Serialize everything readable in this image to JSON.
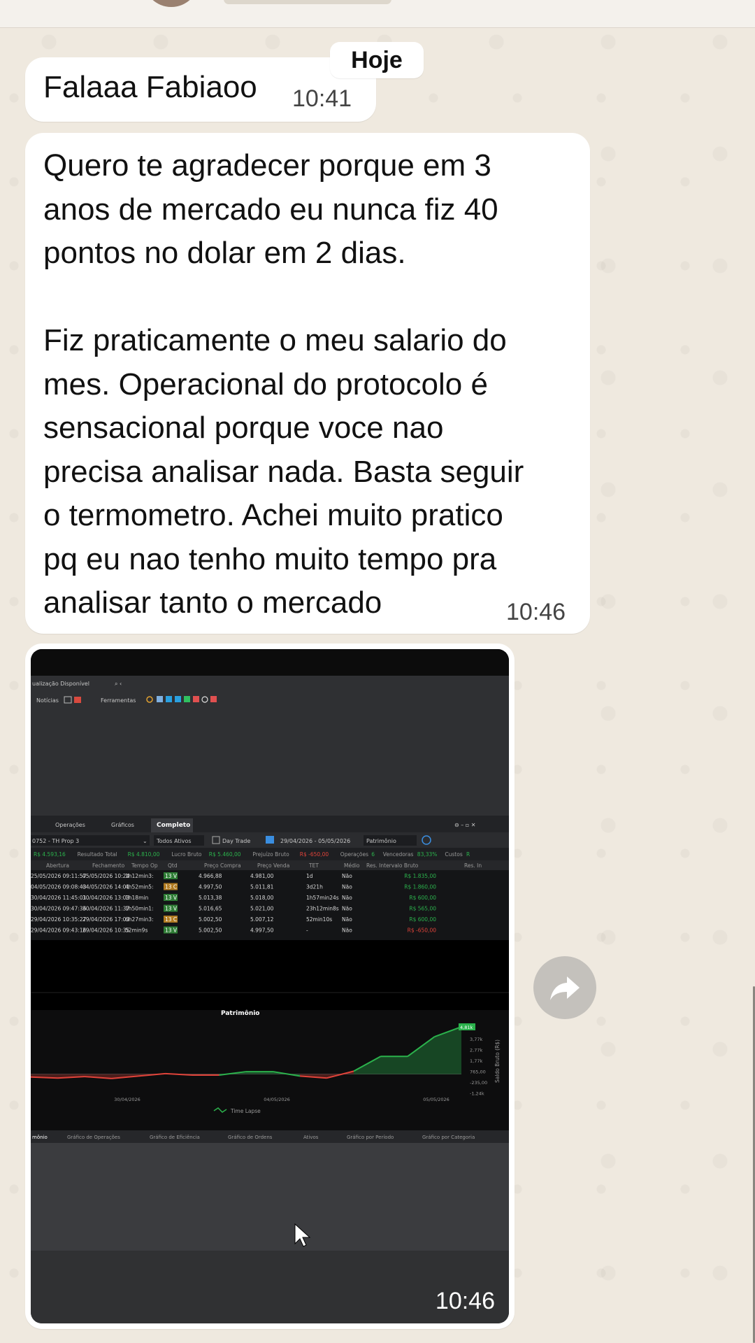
{
  "date_chip": "Hoje",
  "messages": [
    {
      "text": "Falaaa Fabiaoo",
      "time": "10:41"
    },
    {
      "text": "Quero te agradecer porque em 3\nanos de mercado eu nunca fiz 40\npontos no dolar em 2 dias.\n\nFiz praticamente o meu salario do\nmes. Operacional do protocolo é\nsensacional porque voce nao\nprecisa analisar nada. Basta seguir\no termometro. Achei muito pratico\npq eu nao tenho muito tempo pra\nanalisar tanto o mercado",
      "time": "10:46"
    }
  ],
  "media_message": {
    "time": "10:46",
    "forward_icon": "forward-arrow-icon",
    "screenshot": {
      "top_bar_text": "ualização Disponível",
      "menu": [
        "Notícias",
        "Ferramentas"
      ],
      "tabs": [
        "Operações",
        "Gráficos",
        "Completo"
      ],
      "filters": {
        "account": "0752 - TH Prop 3",
        "assets": "Todos Ativos",
        "day_trade": "Day Trade",
        "date_range": "29/04/2026 - 05/05/2026",
        "view": "Patrimônio"
      },
      "summary": [
        {
          "label": "",
          "value": "R$ 4.593,16"
        },
        {
          "label": "Resultado Total",
          "value": "R$ 4.810,00"
        },
        {
          "label": "Lucro Bruto",
          "value": "R$ 5.460,00"
        },
        {
          "label": "Prejuízo Bruto",
          "value": "R$ -650,00"
        },
        {
          "label": "Operações",
          "value": "6"
        },
        {
          "label": "Vencedoras",
          "value": "83,33%"
        },
        {
          "label": "Custos",
          "value": "R"
        }
      ],
      "columns": [
        "Abertura",
        "Fechamento",
        "Tempo Op",
        "Qtd",
        "Preço Compra",
        "Preço Venda",
        "TET",
        "Médio",
        "Res. Intervalo Bruto",
        "Res. In"
      ],
      "rows": [
        [
          "25/05/2026 09:11:57",
          "05/05/2026 10:24",
          "1h12min3:",
          "13 V",
          "4.966,88",
          "4.981,00",
          "1d",
          "Não",
          "R$ 1.835,00"
        ],
        [
          "04/05/2026 09:08:43",
          "04/05/2026 14:01",
          "4h52min5:",
          "13 C",
          "4.997,50",
          "5.011,81",
          "3d21h",
          "Não",
          "R$ 1.860,00"
        ],
        [
          "30/04/2026 11:45:01",
          "30/04/2026 13:03",
          "1h18min",
          "13 V",
          "5.013,38",
          "5.018,00",
          "1h57min24s",
          "Não",
          "R$ 600,00"
        ],
        [
          "30/04/2026 09:47:36",
          "30/04/2026 11:37",
          "1h50min1:",
          "13 V",
          "5.016,65",
          "5.021,00",
          "23h12min8s",
          "Não",
          "R$ 565,00"
        ],
        [
          "29/04/2026 10:35:27",
          "29/04/2026 17:03",
          "6h27min3:",
          "13 C",
          "5.002,50",
          "5.007,12",
          "52min10s",
          "Não",
          "R$ 600,00"
        ],
        [
          "29/04/2026 09:43:16",
          "29/04/2026 10:35",
          "52min9s",
          "13 V",
          "5.002,50",
          "4.997,50",
          "-",
          "Não",
          "R$ -650,00"
        ]
      ],
      "chart_data": {
        "type": "area",
        "title": "Patrimônio",
        "x_ticks": [
          "30/04/2026",
          "04/05/2026",
          "05/05/2026"
        ],
        "y_ticks": [
          "4,81k",
          "3,77k",
          "2,77k",
          "1,77k",
          "765,00",
          "-235,00",
          "-1,24k"
        ],
        "ylabel": "Saldo Bruto (R$)",
        "legend": "Time Lapse",
        "series": [
          {
            "values": [
              -300,
              -400,
              -250,
              -450,
              -200,
              50,
              -100,
              -100,
              250,
              250,
              -200,
              -400,
              300,
              1800,
              1800,
              3800,
              4810
            ]
          }
        ]
      },
      "bottom_tabs": [
        "mônio",
        "Gráfico de Operações",
        "Gráfico de Eficiência",
        "Gráfico de Ordens",
        "Ativos",
        "Gráfico por Período",
        "Gráfico por Categoria"
      ],
      "colors": {
        "positive": "#2bb24c",
        "negative": "#e0433a",
        "background": "#2a2b2e"
      }
    }
  }
}
